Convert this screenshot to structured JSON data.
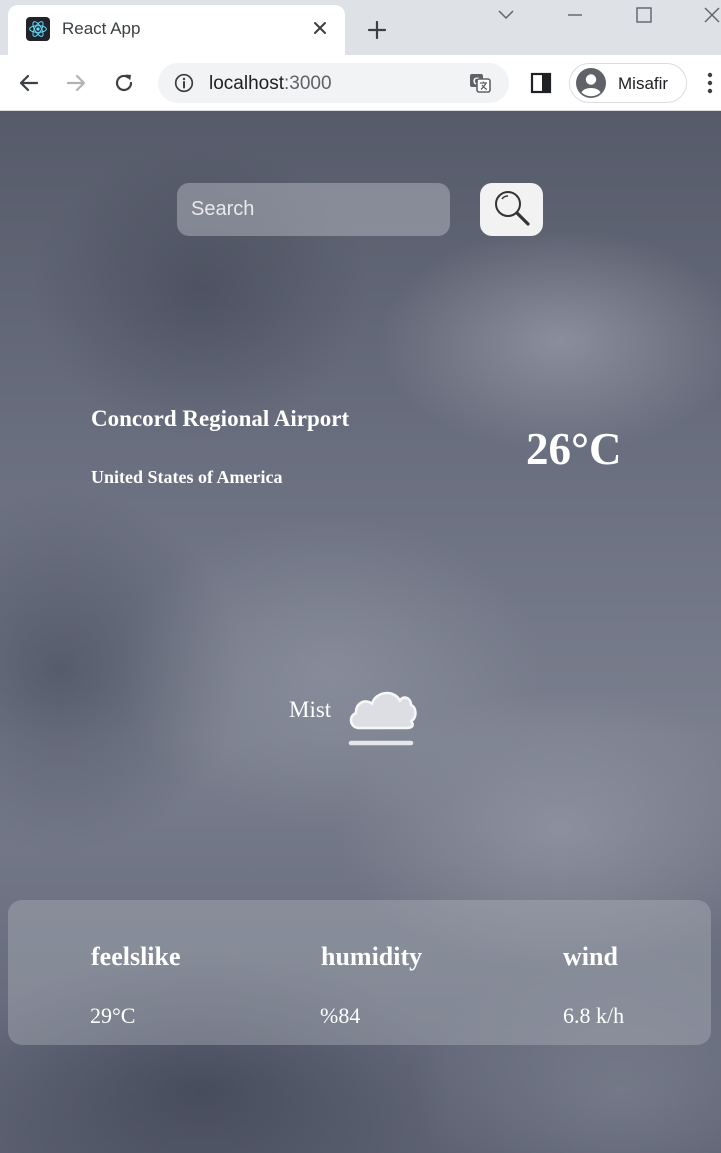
{
  "browser": {
    "tab_title": "React App",
    "url_host": "localhost",
    "url_port": ":3000",
    "profile_name": "Misafir"
  },
  "search": {
    "placeholder": "Search",
    "value": ""
  },
  "location": {
    "name": "Concord Regional Airport",
    "country": "United States of America"
  },
  "current": {
    "temperature": "26°C",
    "condition": "Mist",
    "condition_icon": "cloud-fog-icon"
  },
  "stats": {
    "feelslike_label": "feelslike",
    "feelslike_value": "29°C",
    "humidity_label": "humidity",
    "humidity_value": "%84",
    "wind_label": "wind",
    "wind_value": "6.8 k/h"
  }
}
